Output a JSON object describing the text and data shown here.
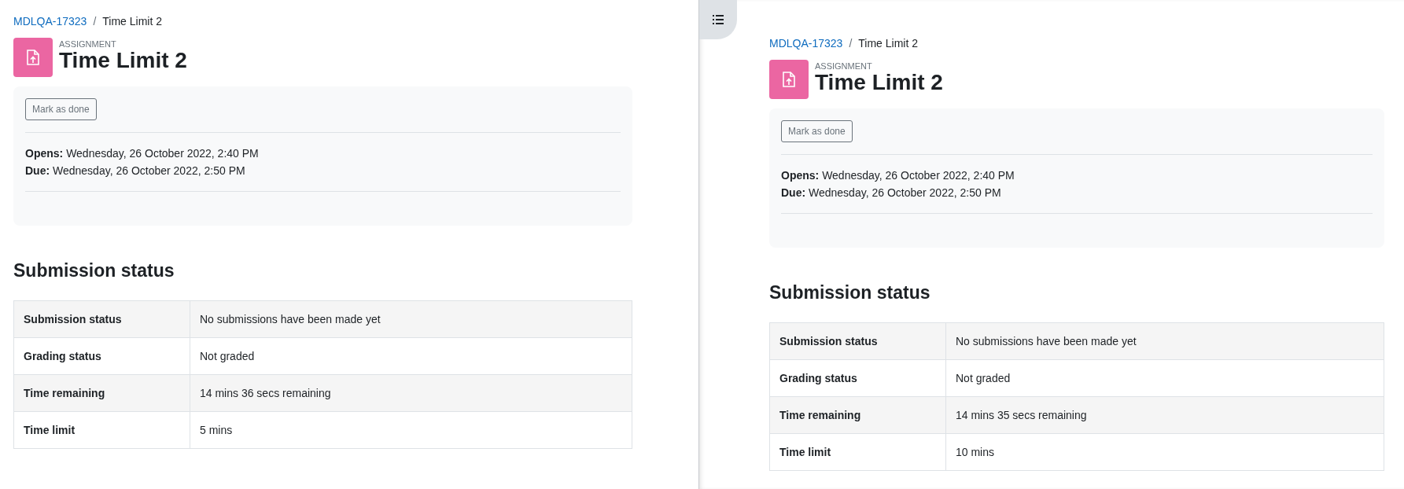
{
  "panes": [
    {
      "breadcrumb": {
        "link": "MDLQA-17323",
        "separator": "/",
        "current": "Time Limit 2"
      },
      "activity_type": "ASSIGNMENT",
      "title": "Time Limit 2",
      "button": "Mark as done",
      "dates": [
        {
          "label": "Opens:",
          "value": "Wednesday, 26 October 2022, 2:40 PM"
        },
        {
          "label": "Due:",
          "value": "Wednesday, 26 October 2022, 2:50 PM"
        }
      ],
      "section_heading": "Submission status",
      "rows": [
        {
          "label": "Submission status",
          "value": "No submissions have been made yet"
        },
        {
          "label": "Grading status",
          "value": "Not graded"
        },
        {
          "label": "Time remaining",
          "value": "14 mins 36 secs remaining"
        },
        {
          "label": "Time limit",
          "value": "5 mins"
        }
      ]
    },
    {
      "breadcrumb": {
        "link": "MDLQA-17323",
        "separator": "/",
        "current": "Time Limit 2"
      },
      "activity_type": "ASSIGNMENT",
      "title": "Time Limit 2",
      "button": "Mark as done",
      "dates": [
        {
          "label": "Opens:",
          "value": "Wednesday, 26 October 2022, 2:40 PM"
        },
        {
          "label": "Due:",
          "value": "Wednesday, 26 October 2022, 2:50 PM"
        }
      ],
      "section_heading": "Submission status",
      "rows": [
        {
          "label": "Submission status",
          "value": "No submissions have been made yet"
        },
        {
          "label": "Grading status",
          "value": "Not graded"
        },
        {
          "label": "Time remaining",
          "value": "14 mins 35 secs remaining"
        },
        {
          "label": "Time limit",
          "value": "10 mins"
        }
      ]
    }
  ]
}
